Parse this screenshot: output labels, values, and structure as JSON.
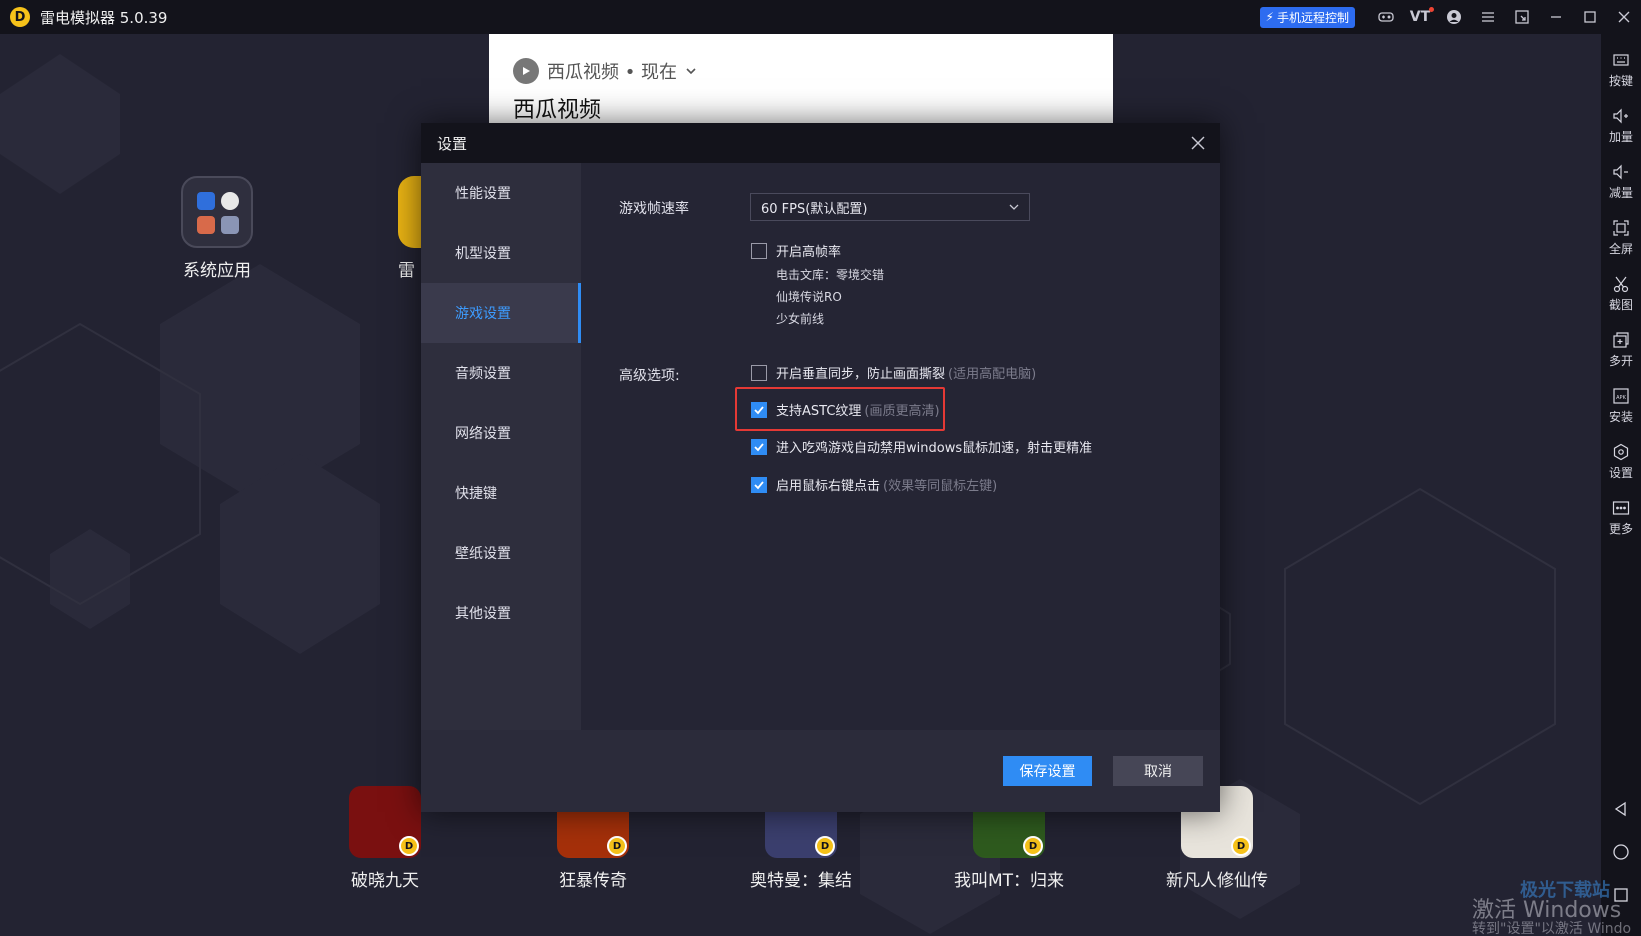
{
  "titlebar": {
    "app_title": "雷电模拟器 5.0.39",
    "remote_label": "手机远程控制",
    "vt_label": "VT",
    "icons": [
      "gamepad-icon",
      "vt-icon",
      "user-icon",
      "menu-icon",
      "shrink-icon",
      "minimize-icon",
      "maximize-icon",
      "close-icon"
    ]
  },
  "desktop": {
    "sys_app_label": "系统应用",
    "partial_app_label": "雷",
    "dock_apps": [
      {
        "label": "破晓九天",
        "color": "#7a1010"
      },
      {
        "label": "狂暴传奇",
        "color": "#a5300a"
      },
      {
        "label": "奥特曼：集结",
        "color": "#3b3f6e"
      },
      {
        "label": "我叫MT：归来",
        "color": "#2e5a1e"
      },
      {
        "label": "新凡人修仙传",
        "color": "#e8e4dc"
      }
    ]
  },
  "notification": {
    "source": "西瓜视频 • 现在",
    "title": "西瓜视频"
  },
  "rightbar": {
    "items": [
      {
        "label": "按键",
        "icon": "keyboard-icon"
      },
      {
        "label": "加量",
        "icon": "volume-up-icon"
      },
      {
        "label": "减量",
        "icon": "volume-down-icon"
      },
      {
        "label": "全屏",
        "icon": "fullscreen-icon"
      },
      {
        "label": "截图",
        "icon": "scissors-icon"
      },
      {
        "label": "多开",
        "icon": "multi-instance-icon"
      },
      {
        "label": "安装",
        "icon": "apk-install-icon"
      },
      {
        "label": "设置",
        "icon": "settings-icon"
      },
      {
        "label": "更多",
        "icon": "more-icon"
      }
    ]
  },
  "dialog": {
    "title": "设置",
    "sidebar": [
      {
        "label": "性能设置"
      },
      {
        "label": "机型设置"
      },
      {
        "label": "游戏设置",
        "active": true
      },
      {
        "label": "音频设置"
      },
      {
        "label": "网络设置"
      },
      {
        "label": "快捷键"
      },
      {
        "label": "壁纸设置"
      },
      {
        "label": "其他设置"
      }
    ],
    "fps_label": "游戏帧速率",
    "fps_value": "60 FPS(默认配置)",
    "high_fps": {
      "label": "开启高帧率",
      "checked": false
    },
    "high_fps_games": [
      "电击文库：零境交错",
      "仙境传说RO",
      "少女前线"
    ],
    "advanced_label": "高级选项:",
    "options": [
      {
        "label": "开启垂直同步，防止画面撕裂",
        "hint": "(适用高配电脑)",
        "checked": false
      },
      {
        "label": "支持ASTC纹理",
        "hint": "(画质更高清)",
        "checked": true
      },
      {
        "label": "进入吃鸡游戏自动禁用windows鼠标加速，射击更精准",
        "hint": "",
        "checked": true
      },
      {
        "label": "启用鼠标右键点击",
        "hint": "(效果等同鼠标左键)",
        "checked": true
      }
    ],
    "save_label": "保存设置",
    "cancel_label": "取消"
  },
  "watermark": {
    "line1": "激活 Windows",
    "line2": "转到\"设置\"以激活 Windo",
    "site": "极光下载站"
  },
  "colors": {
    "accent": "#2f8cf4",
    "highlight": "#e53935",
    "titlebar_bg": "#13131b",
    "desktop_bg": "#232332"
  }
}
